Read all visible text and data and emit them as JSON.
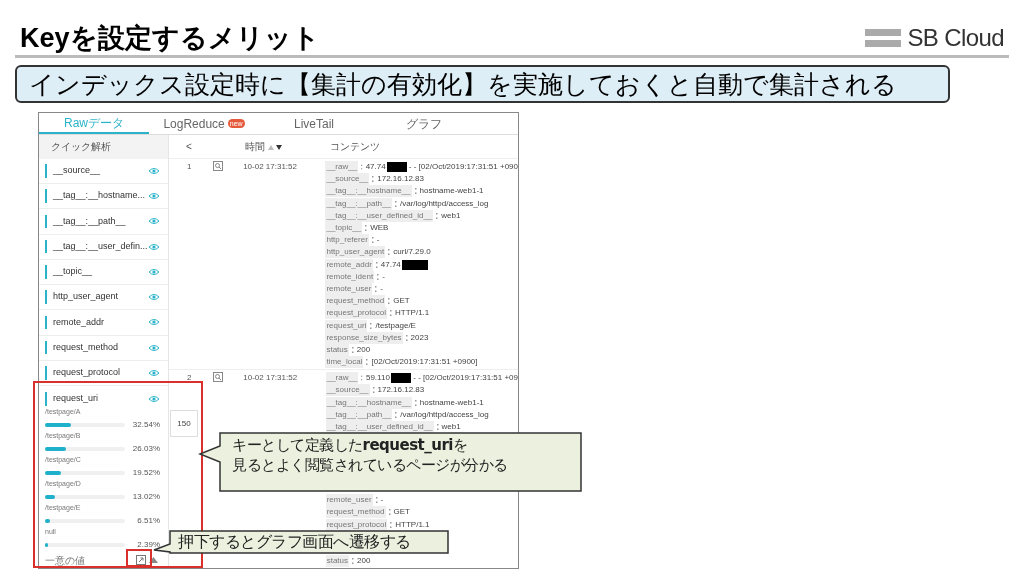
{
  "slide": {
    "title": "Keyを設定するメリット",
    "logo": "SB Cloud",
    "banner": "インデックス設定時に【集計の有効化】を実施しておくと自動で集計される"
  },
  "tabs": [
    {
      "label": "Rawデータ",
      "selected": true
    },
    {
      "label": "LogReduce",
      "selected": false,
      "badge": "new"
    },
    {
      "label": "LiveTail",
      "selected": false
    },
    {
      "label": "グラフ",
      "selected": false
    }
  ],
  "sidebar": {
    "header": "クイック解析",
    "fields": [
      {
        "name": "__source__"
      },
      {
        "name": "__tag__:__hostname..."
      },
      {
        "name": "__tag__:__path__"
      },
      {
        "name": "__tag__:__user_defin..."
      },
      {
        "name": "__topic__"
      },
      {
        "name": "http_user_agent"
      },
      {
        "name": "remote_addr"
      },
      {
        "name": "request_method"
      },
      {
        "name": "request_protocol"
      }
    ],
    "expanded": {
      "name": "request_uri",
      "values": [
        {
          "label": "/testpage/A",
          "percent": "32.54%",
          "level": 0.3254
        },
        {
          "label": "/testpage/B",
          "percent": "26.03%",
          "level": 0.2603
        },
        {
          "label": "/testpage/C",
          "percent": "19.52%",
          "level": 0.1952
        },
        {
          "label": "/testpage/D",
          "percent": "13.02%",
          "level": 0.1302
        },
        {
          "label": "/testpage/E",
          "percent": "6.51%",
          "level": 0.0651
        },
        {
          "label": "null",
          "percent": "2.39%",
          "level": 0.0239
        }
      ],
      "footer": "一意の値"
    }
  },
  "table": {
    "collapse": "<",
    "columns": [
      "時間",
      "コンテンツ"
    ],
    "rows": [
      {
        "index": "1",
        "time": "10-02 17:31:52",
        "entries": [
          {
            "key": "__raw__",
            "value": "47.74",
            "redacted": true,
            "rest": "- - [02/Oct/2019:17:31:51 +090"
          },
          {
            "key": "__source__",
            "value": "172.16.12.83"
          },
          {
            "key": "__tag__:__hostname__",
            "value": "hostname-web1-1"
          },
          {
            "key": "__tag__:__path__",
            "value": "/var/log/httpd/access_log"
          },
          {
            "key": "__tag__:__user_defined_id__",
            "value": "web1"
          },
          {
            "key": "__topic__",
            "value": "WEB"
          },
          {
            "key": "http_referer",
            "value": "-"
          },
          {
            "key": "http_user_agent",
            "value": "curl/7.29.0"
          },
          {
            "key": "remote_addr",
            "value": "47.74",
            "redacted": true
          },
          {
            "key": "remote_ident",
            "value": "-"
          },
          {
            "key": "remote_user",
            "value": "-"
          },
          {
            "key": "request_method",
            "value": "GET"
          },
          {
            "key": "request_protocol",
            "value": "HTTP/1.1"
          },
          {
            "key": "request_uri",
            "value": "/testpage/E"
          },
          {
            "key": "response_size_bytes",
            "value": "2023"
          },
          {
            "key": "status",
            "value": "200"
          },
          {
            "key": "time_local",
            "value": "[02/Oct/2019:17:31:51 +0900]"
          }
        ]
      },
      {
        "index": "2",
        "time": "10-02 17:31:52",
        "blocks": [
          [
            {
              "key": "__raw__",
              "value": "59.110",
              "redacted": true,
              "rest": "- - [02/Oct/2019:17:31:51 +09"
            },
            {
              "key": "__source__",
              "value": "172.16.12.83"
            },
            {
              "key": "__tag__:__hostname__",
              "value": "hostname-web1-1"
            },
            {
              "key": "__tag__:__path__",
              "value": "/var/log/httpd/access_log"
            },
            {
              "key": "__tag__:__user_defined_id__",
              "value": "web1"
            }
          ],
          [
            {
              "key": "remote_user",
              "value": "-"
            },
            {
              "key": "request_method",
              "value": "GET"
            },
            {
              "key": "request_protocol",
              "value": "HTTP/1.1"
            }
          ],
          [
            {
              "key": "status",
              "value": "200"
            }
          ]
        ]
      }
    ]
  },
  "tooltip": "150",
  "callouts": [
    {
      "kind": "large",
      "lines": [
        "キーとして定義した**request_uri**を",
        "見るとよく閲覧されているページが分かる"
      ]
    },
    {
      "kind": "small",
      "text": "押下するとグラフ画面へ遷移する"
    }
  ]
}
